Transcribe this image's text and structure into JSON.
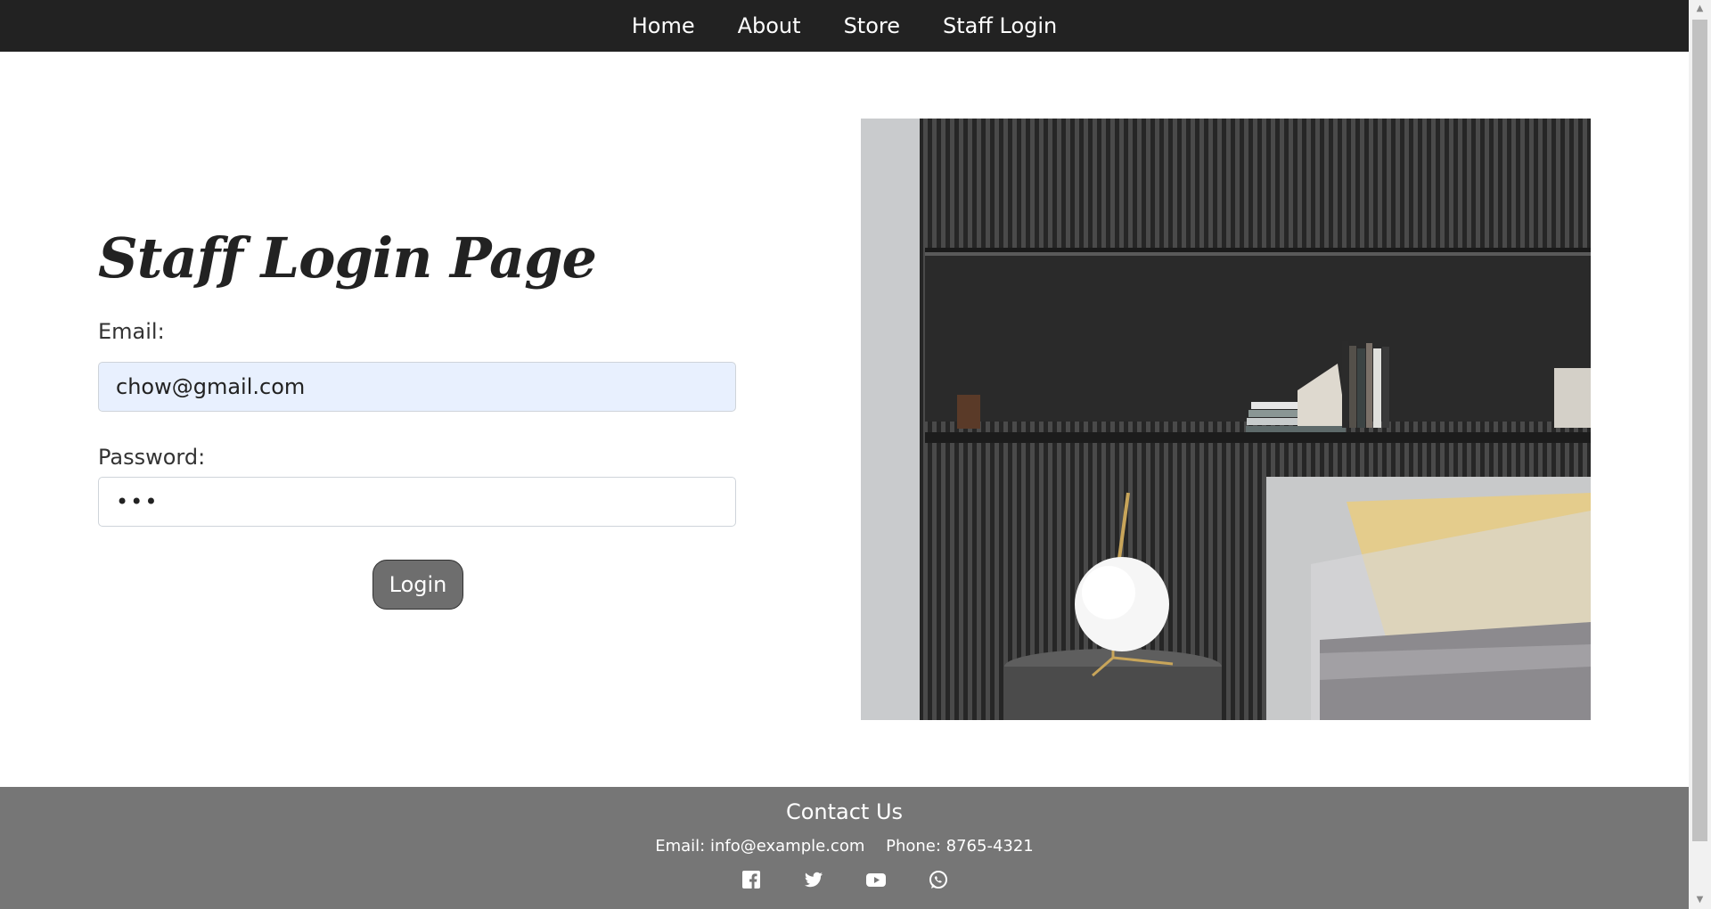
{
  "nav": {
    "items": [
      {
        "label": "Home"
      },
      {
        "label": "About"
      },
      {
        "label": "Store"
      },
      {
        "label": "Staff Login"
      }
    ]
  },
  "login": {
    "title": "Staff Login Page",
    "email_label": "Email:",
    "email_value": "chow@gmail.com",
    "password_label": "Password:",
    "password_value": "•••",
    "button_label": "Login"
  },
  "footer": {
    "heading": "Contact Us",
    "email": "Email: info@example.com",
    "phone": "Phone: 8765-4321",
    "icons": [
      "facebook-icon",
      "twitter-icon",
      "youtube-icon",
      "whatsapp-icon"
    ]
  },
  "colors": {
    "nav_bg": "#222222",
    "footer_bg": "#767676",
    "button_bg": "#6e6e6e",
    "autofill_bg": "#e8f0fe"
  }
}
